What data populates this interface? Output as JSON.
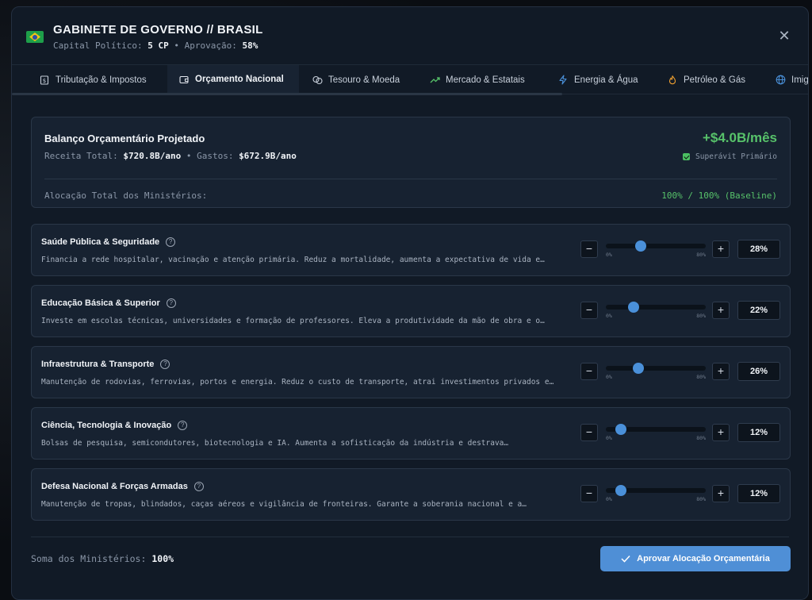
{
  "header": {
    "title": "GABINETE DE GOVERNO // BRASIL",
    "political_capital_label": "Capital Político:",
    "political_capital_value": "5 CP",
    "separator": "•",
    "approval_label": "Aprovação:",
    "approval_value": "58%",
    "close_label": "✕"
  },
  "tabs": [
    {
      "label": "Tributação & Impostos",
      "icon": "tax-icon",
      "active": false
    },
    {
      "label": "Orçamento Nacional",
      "icon": "wallet-icon",
      "active": true
    },
    {
      "label": "Tesouro & Moeda",
      "icon": "coins-icon",
      "active": false
    },
    {
      "label": "Mercado & Estatais",
      "icon": "trend-up-icon",
      "active": false
    },
    {
      "label": "Energia & Água",
      "icon": "lightning-icon",
      "active": false
    },
    {
      "label": "Petróleo & Gás",
      "icon": "flame-icon",
      "active": false
    },
    {
      "label": "Imigração",
      "icon": "globe-icon",
      "active": false
    }
  ],
  "balance": {
    "title": "Balanço Orçamentário Projetado",
    "revenue_label": "Receita Total:",
    "revenue_value": "$720.8B/ano",
    "separator": "•",
    "expense_label": "Gastos:",
    "expense_value": "$672.9B/ano",
    "amount": "+$4.0B/mês",
    "status": "Superávit Primário",
    "allocation_label": "Alocação Total dos Ministérios:",
    "allocation_value": "100% / 100% (Baseline)",
    "accent_color": "#57c26a"
  },
  "slider_min_label": "0%",
  "slider_max_label": "80%",
  "slider_max": 80,
  "ministries": [
    {
      "name": "Saúde Pública & Seguridade",
      "description": "Financia a rede hospitalar, vacinação e atenção primária. Reduz a mortalidade, aumenta a expectativa de vida e…",
      "value": 28,
      "value_label": "28%"
    },
    {
      "name": "Educação Básica & Superior",
      "description": "Investe em escolas técnicas, universidades e formação de professores. Eleva a produtividade da mão de obra e o…",
      "value": 22,
      "value_label": "22%"
    },
    {
      "name": "Infraestrutura & Transporte",
      "description": "Manutenção de rodovias, ferrovias, portos e energia. Reduz o custo de transporte, atrai investimentos privados e…",
      "value": 26,
      "value_label": "26%"
    },
    {
      "name": "Ciência, Tecnologia & Inovação",
      "description": "Bolsas de pesquisa, semicondutores, biotecnologia e IA. Aumenta a sofisticação da indústria e destrava…",
      "value": 12,
      "value_label": "12%"
    },
    {
      "name": "Defesa Nacional & Forças Armadas",
      "description": "Manutenção de tropas, blindados, caças aéreos e vigilância de fronteiras. Garante a soberania nacional e a…",
      "value": 12,
      "value_label": "12%"
    }
  ],
  "footer": {
    "sum_label": "Soma dos Ministérios:",
    "sum_value": "100%",
    "approve_label": "Aprovar Alocação Orçamentária"
  },
  "colors": {
    "accent": "#4f8fd6",
    "success": "#57c26a",
    "background": "#111a26"
  }
}
